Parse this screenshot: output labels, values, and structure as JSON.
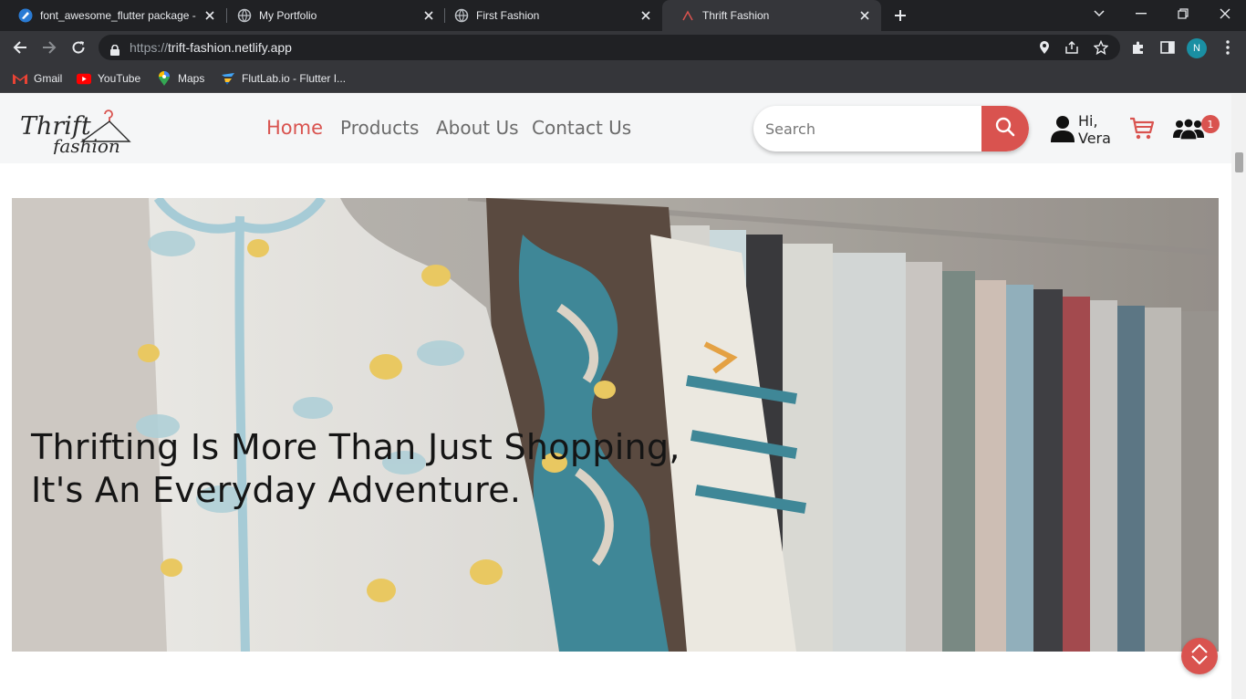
{
  "browser": {
    "tabs": [
      {
        "title": "font_awesome_flutter package - ",
        "icon": "dart-icon"
      },
      {
        "title": "My Portfolio",
        "icon": "globe-icon"
      },
      {
        "title": "First Fashion",
        "icon": "globe-icon"
      },
      {
        "title": "Thrift Fashion",
        "icon": "thrift-fashion-favicon"
      }
    ],
    "url_scheme": "https://",
    "url_host": "trift-fashion.netlify.app",
    "profile_initial": "N",
    "bookmarks": [
      {
        "label": "Gmail",
        "icon": "gmail-icon"
      },
      {
        "label": "YouTube",
        "icon": "youtube-icon"
      },
      {
        "label": "Maps",
        "icon": "maps-icon"
      },
      {
        "label": "FlutLab.io - Flutter I...",
        "icon": "flutlab-icon"
      }
    ]
  },
  "site": {
    "logo": {
      "word1": "Thrift",
      "word2": "fashion"
    },
    "nav": [
      {
        "label": "Home",
        "active": true
      },
      {
        "label": "Products",
        "active": false
      },
      {
        "label": "About Us",
        "active": false
      },
      {
        "label": "Contact Us",
        "active": false
      }
    ],
    "search": {
      "placeholder": "Search"
    },
    "user": {
      "greeting_line1": "Hi,",
      "greeting_line2": "Vera"
    },
    "community_badge": "1",
    "hero": {
      "line1": "Thrifting Is More Than Just Shopping,",
      "line2": "It's An Everyday Adventure."
    },
    "colors": {
      "accent": "#d9534f",
      "header_bg": "#f5f6f7",
      "nav_text": "#6b6b6b"
    }
  }
}
